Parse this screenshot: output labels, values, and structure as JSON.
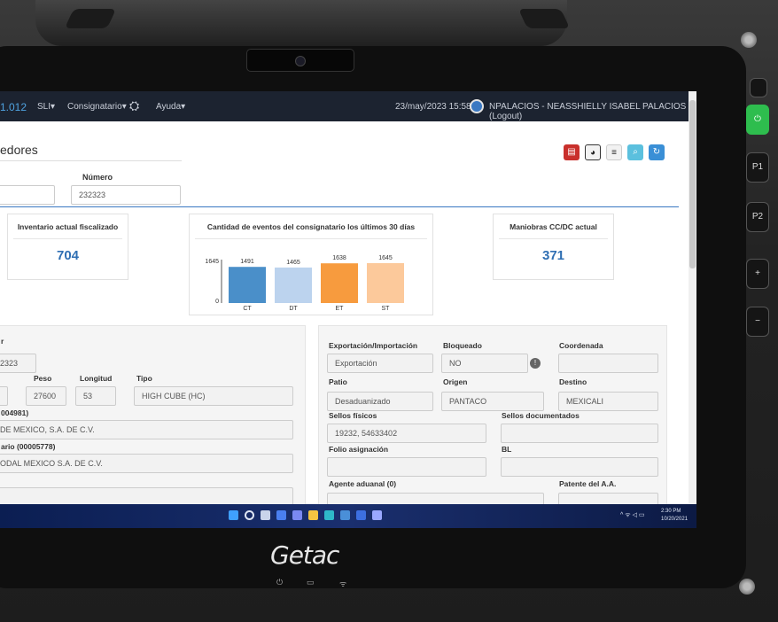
{
  "device": {
    "brand": "Getac",
    "side_buttons": [
      "P1",
      "P2",
      "+",
      "−"
    ]
  },
  "navbar": {
    "version": "1.012",
    "menus": [
      "SLI▾",
      "Consignatario▾",
      "Ayuda▾"
    ],
    "datetime": "23/may/2023 15:58",
    "user": "NPALACIOS - NEASSHIELLY ISABEL PALACIOS (Logout)"
  },
  "page": {
    "title": "edores",
    "numero_label": "Número",
    "numero_value": "232323"
  },
  "cards": {
    "inventario": {
      "title": "Inventario actual fiscalizado",
      "value": "704"
    },
    "eventos": {
      "title": "Cantidad de eventos del consignatario los últimos 30 días"
    },
    "maniobras": {
      "title": "Maniobras CC/DC actual",
      "value": "371"
    }
  },
  "chart_data": {
    "type": "bar",
    "categories": [
      "CT",
      "DT",
      "ET",
      "ST"
    ],
    "values": [
      1491,
      1465,
      1638,
      1645
    ],
    "colors": [
      "#4a8fc9",
      "#bcd3ee",
      "#f79b3e",
      "#fcc99b"
    ],
    "ylim": [
      0,
      1645
    ],
    "yticks": [
      "1645",
      "0"
    ]
  },
  "left_panel": {
    "header": "r",
    "contenedor": "2323",
    "peso_label": "Peso",
    "peso_value": "27600",
    "longitud_label": "Longitud",
    "longitud_value": "53",
    "tipo_label": "Tipo",
    "tipo_value": "HIGH CUBE (HC)",
    "cliente_label": "004981)",
    "cliente_value": "DE MEXICO, S.A. DE C.V.",
    "destinatario_label": "ario (00005778)",
    "destinatario_value": "ODAL MEXICO S.A. DE C.V."
  },
  "right_panel": {
    "expimp_label": "Exportación/Importación",
    "expimp_value": "Exportación",
    "bloqueado_label": "Bloqueado",
    "bloqueado_value": "NO",
    "coordenada_label": "Coordenada",
    "coordenada_value": "",
    "patio_label": "Patio",
    "patio_value": "Desaduanizado",
    "origen_label": "Origen",
    "origen_value": "PANTACO",
    "destino_label": "Destino",
    "destino_value": "MEXICALI",
    "sellos_fisicos_label": "Sellos físicos",
    "sellos_fisicos_value": "19232, 54633402",
    "sellos_doc_label": "Sellos documentados",
    "folio_label": "Folio asignación",
    "bl_label": "BL",
    "agente_label": "Agente aduanal (0)",
    "patente_label": "Patente del A.A."
  },
  "taskbar": {
    "time": "2:30 PM",
    "date": "10/20/2021"
  }
}
